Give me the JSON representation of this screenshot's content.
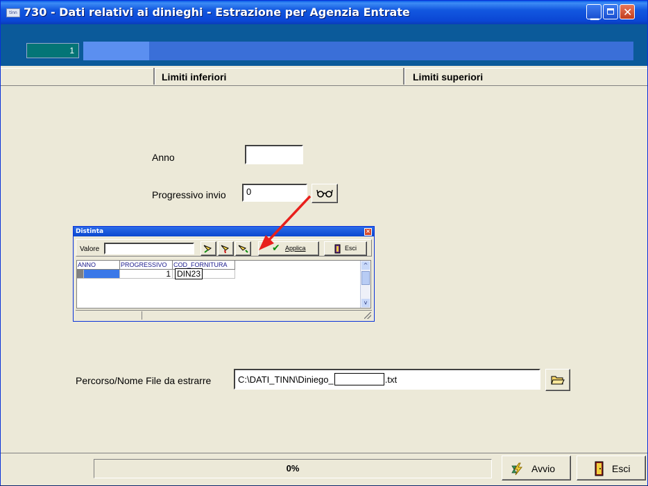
{
  "window": {
    "title": "730 - Dati relativi ai dinieghi - Estrazione per Agenzia Entrate",
    "app_icon_text": "tinn"
  },
  "record_indicator": "1",
  "top_progress": {
    "fraction": 0.12
  },
  "columns": {
    "lower": "Limiti inferiori",
    "upper": "Limiti superiori"
  },
  "form": {
    "anno_label": "Anno",
    "anno_value": "",
    "progressivo_label": "Progressivo invio",
    "progressivo_value": "0",
    "path_label": "Percorso/Nome File da estrarre",
    "path_prefix": "C:\\DATI_TINN\\Diniego_",
    "path_suffix": ".txt"
  },
  "popup": {
    "title": "Distinta",
    "valore_label": "Valore",
    "valore_value": "",
    "applica_label": "Applica",
    "esci_label": "Esci",
    "grid": {
      "headers": [
        "ANNO",
        "PROGRESSIVO",
        "COD_FORNITURA"
      ],
      "rows": [
        [
          "",
          "1",
          "DIN23"
        ]
      ]
    }
  },
  "footer": {
    "percent": "0%",
    "avvio_label": "Avvio",
    "esci_label": "Esci"
  },
  "colors": {
    "title_bar": "#0b47d4",
    "top_strip": "#0b5a9a",
    "form_bg": "#ece9d8",
    "arrow": "#e8201c"
  }
}
